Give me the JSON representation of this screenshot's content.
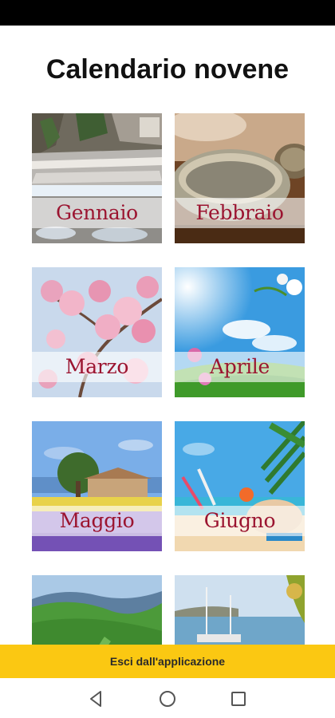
{
  "header": {
    "title": "Calendario novene"
  },
  "months": [
    {
      "label": "Gennaio",
      "scene": "river-icon"
    },
    {
      "label": "Febbraio",
      "scene": "bowl-icon"
    },
    {
      "label": "Marzo",
      "scene": "cherry-blossom-icon"
    },
    {
      "label": "Aprile",
      "scene": "spring-meadow-icon"
    },
    {
      "label": "Maggio",
      "scene": "lavender-field-icon"
    },
    {
      "label": "Giugno",
      "scene": "beach-icon"
    },
    {
      "label": "",
      "scene": "green-valley-icon"
    },
    {
      "label": "",
      "scene": "harbor-icon"
    }
  ],
  "footer": {
    "exit_label": "Esci dall'applicazione"
  },
  "nav": {
    "back_icon": "back-triangle-icon",
    "home_icon": "home-circle-icon",
    "recents_icon": "recents-square-icon"
  },
  "colors": {
    "exit_bar": "#fbc812",
    "label_text": "#9b1430",
    "status_bar": "#000000"
  }
}
